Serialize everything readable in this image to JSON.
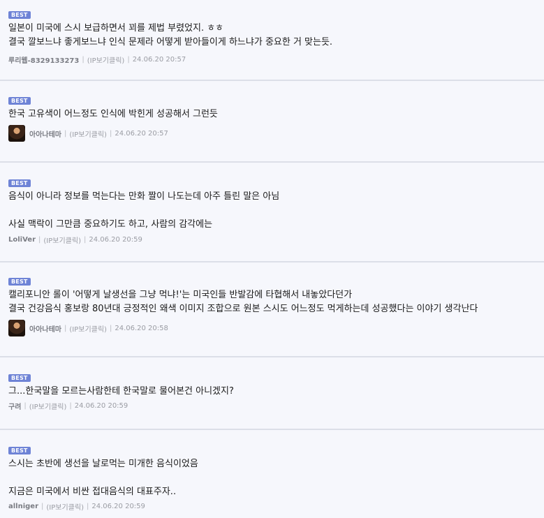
{
  "badge_label": "BEST",
  "separator": "|",
  "comments": [
    {
      "lines": [
        "일본이 미국에 스시 보급하면서 꾀를 제법 부렸었지. ㅎㅎ",
        "결국 깔보느냐 좋게보느냐 인식 문제라 어떻게 받아들이게 하느냐가 중요한 거 맞는듯."
      ],
      "author": "루리웹-8329133273",
      "ip_label": "(IP보기클릭)",
      "date": "24.06.20 20:57"
    },
    {
      "lines": [
        "한국 고유색이 어느정도 인식에 박힌게 성공해서 그런듯"
      ],
      "author": "아아나테마",
      "ip_label": "(IP보기클릭)",
      "date": "24.06.20 20:57"
    },
    {
      "lines": [
        "음식이 아니라 정보를 먹는다는 만화 짤이 나도는데 아주 틀린 말은 아님",
        "",
        "사실 맥락이 그만큼 중요하기도 하고, 사람의 감각에는"
      ],
      "author": "LoliVer",
      "ip_label": "(IP보기클릭)",
      "date": "24.06.20 20:59"
    },
    {
      "lines": [
        "캘리포니안 롤이 '어떻게 날생선을 그냥 먹냐!'는 미국인들 반발감에 타협해서 내놓았다던가",
        "결국 건강음식 홍보랑 80년대 긍정적인 왜색 이미지 조합으로 원본 스시도 어느정도 먹게하는데 성공했다는 이야기 생각난다"
      ],
      "author": "아아나테마",
      "ip_label": "(IP보기클릭)",
      "date": "24.06.20 20:58"
    },
    {
      "lines": [
        "그...한국말을 모르는사람한테 한국말로 물어본건 아니겠지?"
      ],
      "author": "구려",
      "ip_label": "(IP보기클릭)",
      "date": "24.06.20 20:59"
    },
    {
      "lines": [
        "스시는 초반에 생선을 날로먹는 미개한 음식이었음",
        "",
        "지금은 미국에서 비싼 접대음식의 대표주자.."
      ],
      "author": "allniger",
      "ip_label": "(IP보기클릭)",
      "date": "24.06.20 20:59"
    }
  ]
}
